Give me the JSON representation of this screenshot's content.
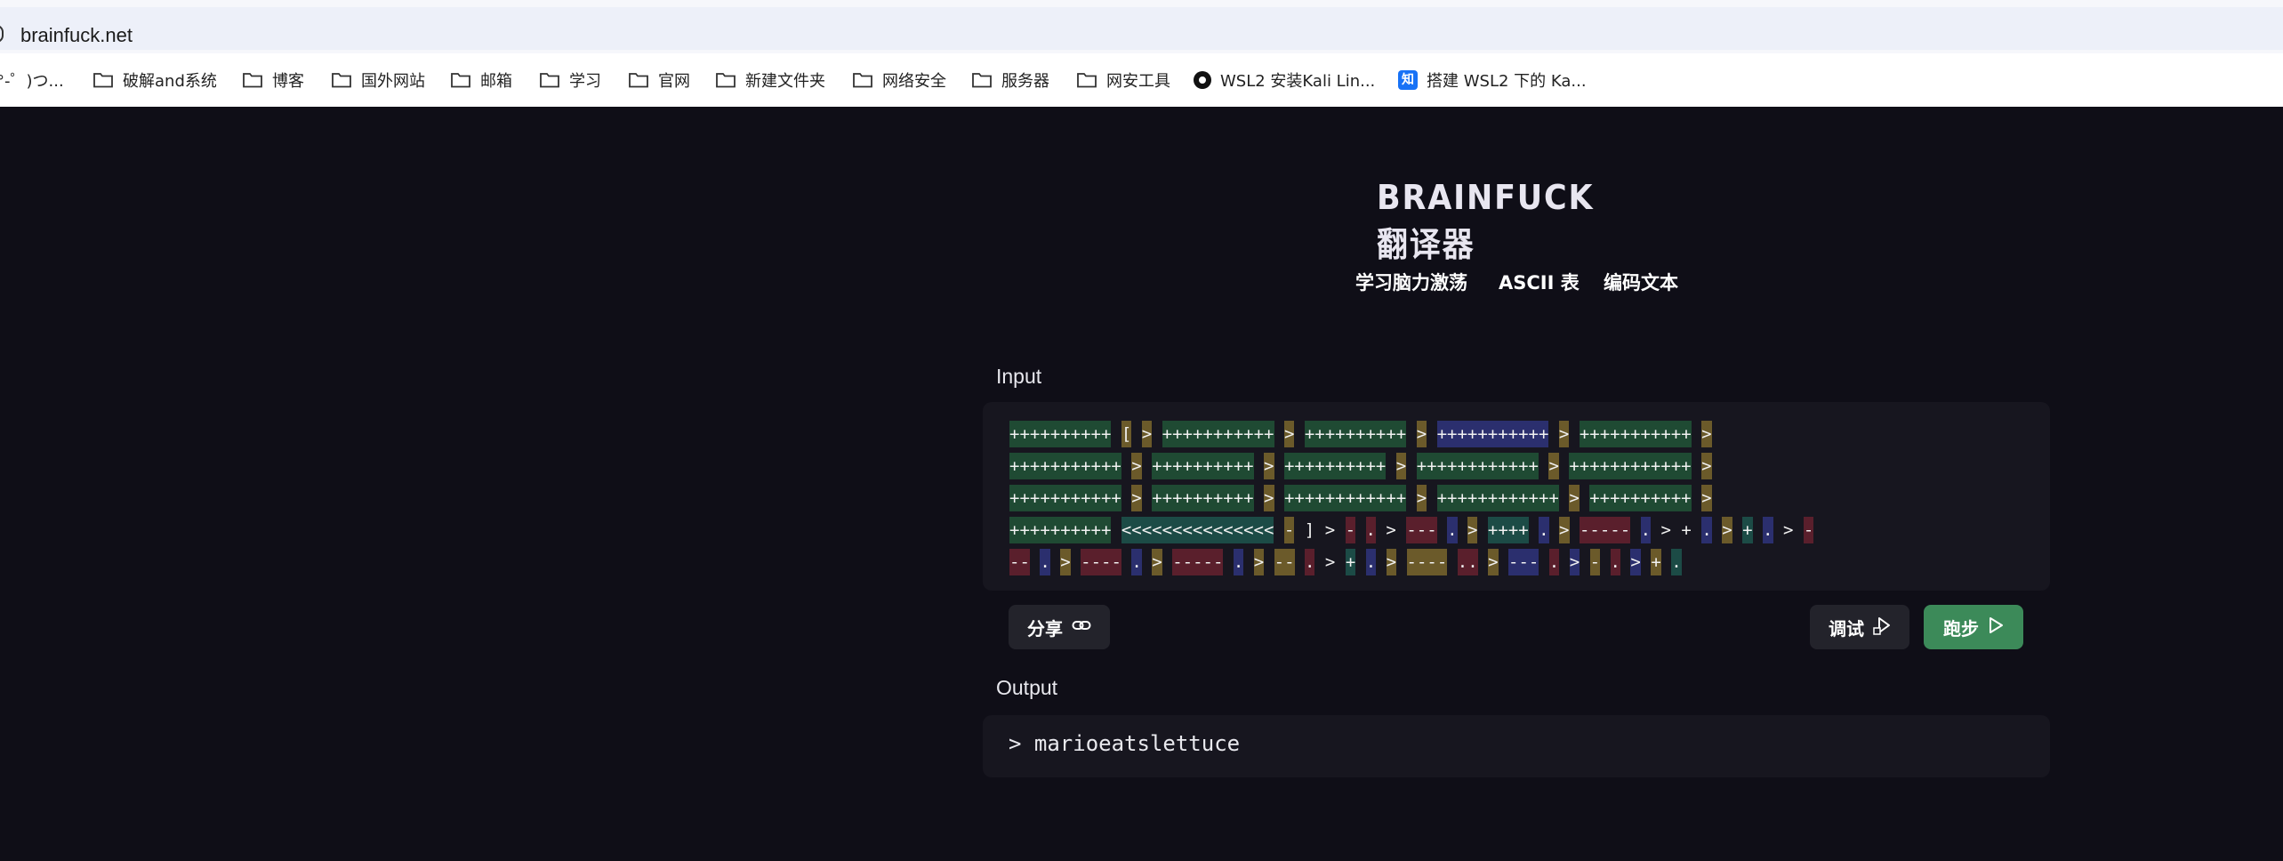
{
  "browser": {
    "url": "brainfuck.net",
    "bookmarks": [
      {
        "label": "°-゜)つ...",
        "icon": "none"
      },
      {
        "label": "破解and系统",
        "icon": "folder-icon"
      },
      {
        "label": "博客",
        "icon": "folder-icon"
      },
      {
        "label": "国外网站",
        "icon": "folder-icon"
      },
      {
        "label": "邮箱",
        "icon": "folder-icon"
      },
      {
        "label": "学习",
        "icon": "folder-icon"
      },
      {
        "label": "官网",
        "icon": "folder-icon"
      },
      {
        "label": "新建文件夹",
        "icon": "folder-icon"
      },
      {
        "label": "网络安全",
        "icon": "folder-icon"
      },
      {
        "label": "服务器",
        "icon": "folder-icon"
      },
      {
        "label": "网安工具",
        "icon": "folder-icon"
      },
      {
        "label": "WSL2 安装Kali Lin...",
        "icon": "circle-site-icon"
      },
      {
        "label": "搭建 WSL2 下的 Ka...",
        "icon": "zhihu-icon"
      }
    ]
  },
  "header": {
    "title": "BRAINFUCK 翻译器",
    "nav": [
      "学习脑力激荡",
      "ASCII 表",
      "编码文本"
    ]
  },
  "input": {
    "label": "Input",
    "lines": [
      [
        [
          "g",
          "++++++++++"
        ],
        [
          "s",
          " "
        ],
        [
          "y",
          "["
        ],
        [
          "s",
          " "
        ],
        [
          "y",
          ">"
        ],
        [
          "s",
          " "
        ],
        [
          "g",
          "+++++++++++"
        ],
        [
          "s",
          " "
        ],
        [
          "y",
          ">"
        ],
        [
          "s",
          " "
        ],
        [
          "g",
          "++++++++++"
        ],
        [
          "s",
          " "
        ],
        [
          "y",
          ">"
        ],
        [
          "s",
          " "
        ],
        [
          "b",
          "+++++++++++"
        ],
        [
          "s",
          " "
        ],
        [
          "y",
          ">"
        ],
        [
          "s",
          " "
        ],
        [
          "g",
          "+++++++++++"
        ],
        [
          "s",
          " "
        ],
        [
          "y",
          ">"
        ]
      ],
      [
        [
          "g",
          "+++++++++++"
        ],
        [
          "s",
          " "
        ],
        [
          "y",
          ">"
        ],
        [
          "s",
          " "
        ],
        [
          "g",
          "++++++++++"
        ],
        [
          "s",
          " "
        ],
        [
          "y",
          ">"
        ],
        [
          "s",
          " "
        ],
        [
          "g",
          "++++++++++"
        ],
        [
          "s",
          " "
        ],
        [
          "y",
          ">"
        ],
        [
          "s",
          " "
        ],
        [
          "g",
          "++++++++++++"
        ],
        [
          "s",
          " "
        ],
        [
          "y",
          ">"
        ],
        [
          "s",
          " "
        ],
        [
          "g",
          "++++++++++++"
        ],
        [
          "s",
          " "
        ],
        [
          "y",
          ">"
        ]
      ],
      [
        [
          "g",
          "+++++++++++"
        ],
        [
          "s",
          " "
        ],
        [
          "y",
          ">"
        ],
        [
          "s",
          " "
        ],
        [
          "g",
          "++++++++++"
        ],
        [
          "s",
          " "
        ],
        [
          "y",
          ">"
        ],
        [
          "s",
          " "
        ],
        [
          "g",
          "++++++++++++"
        ],
        [
          "s",
          " "
        ],
        [
          "y",
          ">"
        ],
        [
          "s",
          " "
        ],
        [
          "g",
          "++++++++++++"
        ],
        [
          "s",
          " "
        ],
        [
          "y",
          ">"
        ],
        [
          "s",
          " "
        ],
        [
          "g",
          "++++++++++"
        ],
        [
          "s",
          " "
        ],
        [
          "y",
          ">"
        ]
      ],
      [
        [
          "g",
          "++++++++++"
        ],
        [
          "s",
          " "
        ],
        [
          "t",
          "<<<<<<<<<<<<<<<"
        ],
        [
          "s",
          " "
        ],
        [
          "y",
          "-"
        ],
        [
          "s",
          " "
        ],
        [
          "s",
          "]"
        ],
        [
          "s",
          " "
        ],
        [
          "s",
          ">"
        ],
        [
          "s",
          " "
        ],
        [
          "r",
          "-"
        ],
        [
          "s",
          " "
        ],
        [
          "r",
          "."
        ],
        [
          "s",
          " "
        ],
        [
          "s",
          ">"
        ],
        [
          "s",
          " "
        ],
        [
          "r",
          "---"
        ],
        [
          "s",
          " "
        ],
        [
          "b",
          "."
        ],
        [
          "s",
          " "
        ],
        [
          "y",
          ">"
        ],
        [
          "s",
          " "
        ],
        [
          "t",
          "++++"
        ],
        [
          "s",
          " "
        ],
        [
          "b",
          "."
        ],
        [
          "s",
          " "
        ],
        [
          "y",
          ">"
        ],
        [
          "s",
          " "
        ],
        [
          "r",
          "-----"
        ],
        [
          "s",
          " "
        ],
        [
          "b",
          "."
        ],
        [
          "s",
          " "
        ],
        [
          "s",
          ">"
        ],
        [
          "s",
          " "
        ],
        [
          "s",
          "+"
        ],
        [
          "s",
          " "
        ],
        [
          "b",
          "."
        ],
        [
          "s",
          " "
        ],
        [
          "y",
          ">"
        ],
        [
          "s",
          " "
        ],
        [
          "t",
          "+"
        ],
        [
          "s",
          " "
        ],
        [
          "b",
          "."
        ],
        [
          "s",
          " "
        ],
        [
          "s",
          ">"
        ],
        [
          "s",
          " "
        ],
        [
          "r",
          "-"
        ]
      ],
      [
        [
          "r",
          "--"
        ],
        [
          "s",
          " "
        ],
        [
          "b",
          "."
        ],
        [
          "s",
          " "
        ],
        [
          "y",
          ">"
        ],
        [
          "s",
          " "
        ],
        [
          "r",
          "----"
        ],
        [
          "s",
          " "
        ],
        [
          "b",
          "."
        ],
        [
          "s",
          " "
        ],
        [
          "y",
          ">"
        ],
        [
          "s",
          " "
        ],
        [
          "r",
          "-----"
        ],
        [
          "s",
          " "
        ],
        [
          "b",
          "."
        ],
        [
          "s",
          " "
        ],
        [
          "y",
          ">"
        ],
        [
          "s",
          " "
        ],
        [
          "y",
          "--"
        ],
        [
          "s",
          " "
        ],
        [
          "r",
          "."
        ],
        [
          "s",
          " "
        ],
        [
          "s",
          ">"
        ],
        [
          "s",
          " "
        ],
        [
          "t",
          "+"
        ],
        [
          "s",
          " "
        ],
        [
          "b",
          "."
        ],
        [
          "s",
          " "
        ],
        [
          "y",
          ">"
        ],
        [
          "s",
          " "
        ],
        [
          "y",
          "----"
        ],
        [
          "s",
          " "
        ],
        [
          "r",
          ".."
        ],
        [
          "s",
          " "
        ],
        [
          "y",
          ">"
        ],
        [
          "s",
          " "
        ],
        [
          "b",
          "---"
        ],
        [
          "s",
          " "
        ],
        [
          "r",
          "."
        ],
        [
          "s",
          " "
        ],
        [
          "b",
          ">"
        ],
        [
          "s",
          " "
        ],
        [
          "y",
          "-"
        ],
        [
          "s",
          " "
        ],
        [
          "r",
          "."
        ],
        [
          "s",
          " "
        ],
        [
          "b",
          ">"
        ],
        [
          "s",
          " "
        ],
        [
          "y",
          "+"
        ],
        [
          "s",
          " "
        ],
        [
          "t",
          "."
        ]
      ]
    ]
  },
  "actions": {
    "share": "分享",
    "debug": "调试",
    "run": "跑步"
  },
  "output": {
    "label": "Output",
    "text": "> marioeatslettuce"
  },
  "colors": {
    "background": "#0f0e17",
    "panel": "#17161f",
    "run_button": "#3c8a59",
    "token_green": "#1f4a33",
    "token_yellow": "#6b5a2a",
    "token_red": "#5a1f2c",
    "token_blue": "#2b2f6e"
  }
}
